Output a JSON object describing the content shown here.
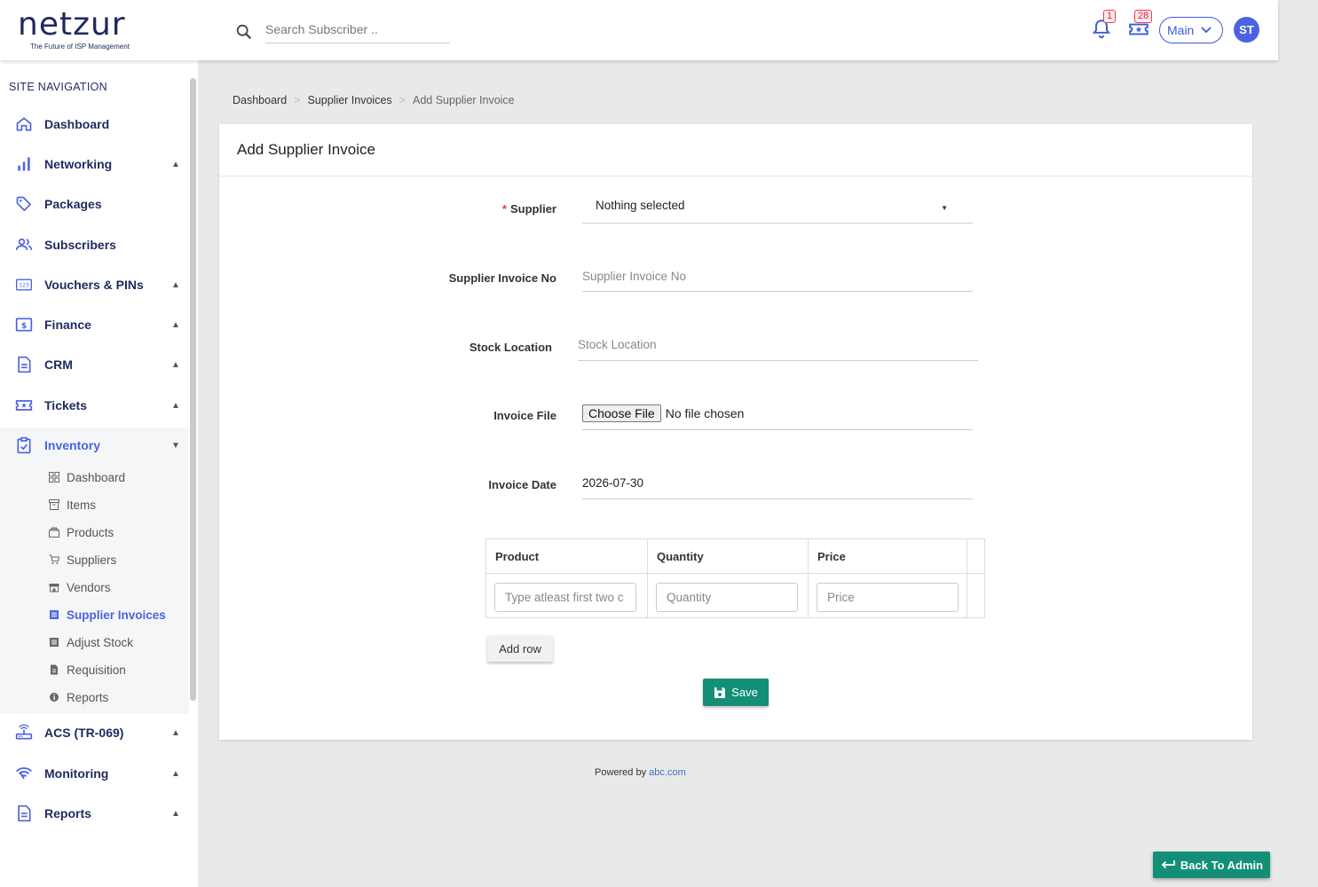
{
  "brand": {
    "name": "netzur",
    "tagline": "The Future of ISP Management"
  },
  "header": {
    "search_placeholder": "Search Subscriber ..",
    "notifications_count": "1",
    "tickets_count": "28",
    "branch": "Main",
    "user_initials": "ST"
  },
  "sidebar": {
    "title": "SITE NAVIGATION",
    "items": [
      {
        "label": "Dashboard",
        "icon": "home-icon"
      },
      {
        "label": "Networking",
        "icon": "bar-chart-icon",
        "caret": "▲"
      },
      {
        "label": "Packages",
        "icon": "tag-icon"
      },
      {
        "label": "Subscribers",
        "icon": "users-icon"
      },
      {
        "label": "Vouchers & PINs",
        "icon": "pin-123-icon",
        "caret": "▲"
      },
      {
        "label": "Finance",
        "icon": "dollar-icon",
        "caret": "▲"
      },
      {
        "label": "CRM",
        "icon": "document-icon",
        "caret": "▲"
      },
      {
        "label": "Tickets",
        "icon": "ticket-icon",
        "caret": "▲"
      },
      {
        "label": "Inventory",
        "icon": "clipboard-check-icon",
        "caret": "▼"
      },
      {
        "label": "ACS (TR-069)",
        "icon": "router-icon",
        "caret": "▲"
      },
      {
        "label": "Monitoring",
        "icon": "wifi-icon",
        "caret": "▲"
      },
      {
        "label": "Reports",
        "icon": "document-icon",
        "caret": "▲"
      }
    ],
    "inventory_sub": [
      {
        "label": "Dashboard",
        "icon": "grid-icon"
      },
      {
        "label": "Items",
        "icon": "archive-icon"
      },
      {
        "label": "Products",
        "icon": "layers-icon"
      },
      {
        "label": "Suppliers",
        "icon": "cart-icon"
      },
      {
        "label": "Vendors",
        "icon": "store-icon"
      },
      {
        "label": "Supplier Invoices",
        "icon": "list-icon"
      },
      {
        "label": "Adjust Stock",
        "icon": "list-icon"
      },
      {
        "label": "Requisition",
        "icon": "file-icon"
      },
      {
        "label": "Reports",
        "icon": "info-icon"
      }
    ]
  },
  "breadcrumb": {
    "home": "Dashboard",
    "parent": "Supplier Invoices",
    "current": "Add Supplier Invoice",
    "separator": ">"
  },
  "form": {
    "title": "Add Supplier Invoice",
    "supplier_label": "Supplier",
    "supplier_value": "Nothing selected",
    "invoice_no_label": "Supplier Invoice No",
    "invoice_no_placeholder": "Supplier Invoice No",
    "stock_location_label": "Stock Location",
    "stock_location_placeholder": "Stock Location",
    "invoice_file_label": "Invoice File",
    "file_button": "Choose File",
    "file_status": "No file chosen",
    "invoice_date_label": "Invoice Date",
    "invoice_date_value": "2026-07-30",
    "table": {
      "headers": [
        "Product",
        "Quantity",
        "Price"
      ],
      "placeholders": [
        "Type atleast first two c",
        "Quantity",
        "Price"
      ]
    },
    "add_row_label": "Add row",
    "save_label": "Save"
  },
  "footer": {
    "prefix": "Powered by",
    "link": "abc.com"
  },
  "back_button": "Back To Admin",
  "colors": {
    "brand_navy": "#1e2a5e",
    "accent_blue": "#4b63e0",
    "primary_green": "#148f77",
    "danger": "#e53935"
  }
}
